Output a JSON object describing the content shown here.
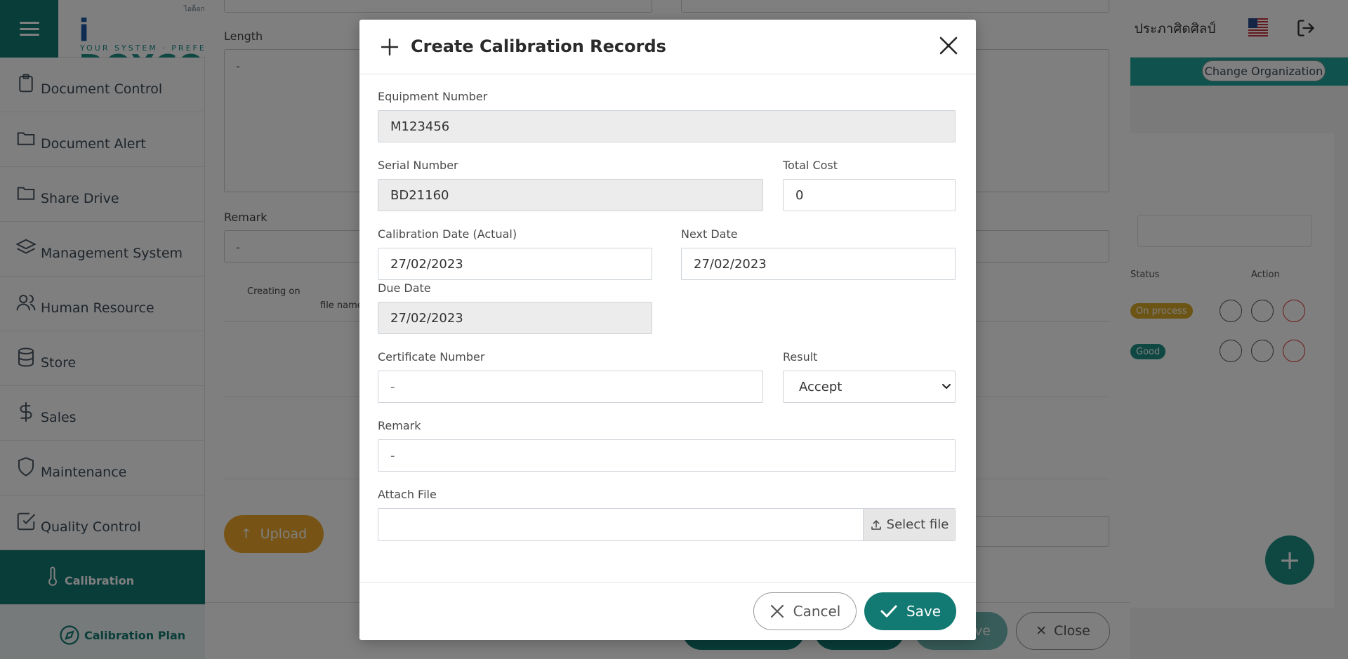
{
  "header": {
    "brand": "DOXCON",
    "brand_prefix": "i",
    "tagline": "YOUR SYSTEM · PREFERENCE",
    "brand_mini": "ไอด็อก",
    "user_name": "ธ์ ประภาศิดศิลป์"
  },
  "sidebar": {
    "items": [
      {
        "label": "Document Control",
        "icon": "clipboard-icon"
      },
      {
        "label": "Document Alert",
        "icon": "folder-icon"
      },
      {
        "label": "Share Drive",
        "icon": "folder-icon"
      },
      {
        "label": "Management System",
        "icon": "layers-icon"
      },
      {
        "label": "Human Resource",
        "icon": "users-icon"
      },
      {
        "label": "Store",
        "icon": "database-icon"
      },
      {
        "label": "Sales",
        "icon": "dollar-icon"
      },
      {
        "label": "Maintenance",
        "icon": "shield-icon"
      },
      {
        "label": "Quality Control",
        "icon": "check-square-icon"
      },
      {
        "label": "Calibration",
        "icon": "thermometer-icon"
      },
      {
        "label": "Calibration Plan",
        "icon": "compass-icon"
      }
    ]
  },
  "background": {
    "change_org": "Change Organization",
    "length_label": "Length",
    "length_value": "-",
    "remark_label": "Remark",
    "remark_value": "-",
    "col_creating_on": "Creating on",
    "col_file_name": "file name",
    "col_status": "Status",
    "col_action": "Action",
    "badge_on_process": "On process",
    "badge_good": "Good",
    "upload_label": "Upload",
    "footer_save_fragment": "ve",
    "footer_close": "Close"
  },
  "modal": {
    "title": "Create Calibration Records",
    "fields": {
      "equipment_number": {
        "label": "Equipment Number",
        "value": "M123456"
      },
      "serial_number": {
        "label": "Serial Number",
        "value": "BD21160"
      },
      "total_cost": {
        "label": "Total Cost",
        "value": "0"
      },
      "calibration_date": {
        "label": "Calibration Date (Actual)",
        "value": "27/02/2023"
      },
      "next_date": {
        "label": "Next Date",
        "value": "27/02/2023"
      },
      "due_date": {
        "label": "Due Date",
        "value": "27/02/2023"
      },
      "certificate_number": {
        "label": "Certificate Number",
        "placeholder": "-"
      },
      "result": {
        "label": "Result",
        "selected": "Accept"
      },
      "remark": {
        "label": "Remark",
        "placeholder": "-"
      },
      "attach_file": {
        "label": "Attach File",
        "button": "Select file"
      }
    },
    "cancel_label": "Cancel",
    "save_label": "Save"
  },
  "colors": {
    "primary": "#137a73",
    "accent_yellow": "#eea92a",
    "danger": "#d33333",
    "badge_on_process": "#d9a82a",
    "badge_good": "#1e8f86"
  }
}
